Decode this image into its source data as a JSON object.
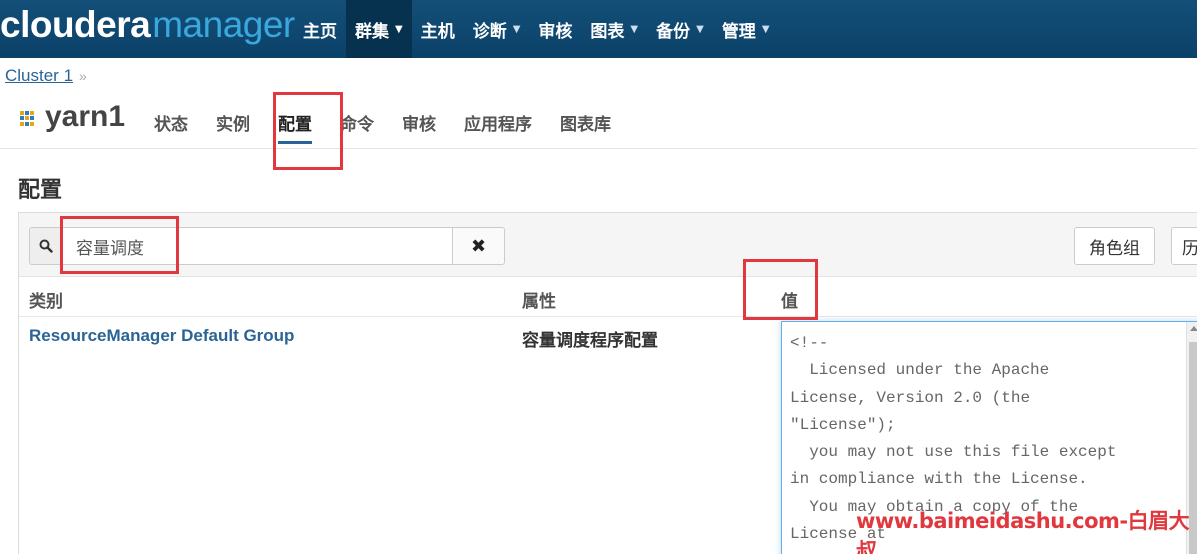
{
  "brand": {
    "part1": "cloudera",
    "part2": "manager"
  },
  "topnav": [
    {
      "label": "主页",
      "caret": false,
      "active": false
    },
    {
      "label": "群集",
      "caret": true,
      "active": true
    },
    {
      "label": "主机",
      "caret": false,
      "active": false
    },
    {
      "label": "诊断",
      "caret": true,
      "active": false
    },
    {
      "label": "审核",
      "caret": false,
      "active": false
    },
    {
      "label": "图表",
      "caret": true,
      "active": false
    },
    {
      "label": "备份",
      "caret": true,
      "active": false
    },
    {
      "label": "管理",
      "caret": true,
      "active": false
    }
  ],
  "breadcrumb": {
    "cluster": "Cluster 1",
    "sep": "»"
  },
  "service": {
    "name": "yarn1",
    "tabs": [
      {
        "label": "状态",
        "active": false
      },
      {
        "label": "实例",
        "active": false
      },
      {
        "label": "配置",
        "active": true
      },
      {
        "label": "命令",
        "active": false
      },
      {
        "label": "审核",
        "active": false
      },
      {
        "label": "应用程序",
        "active": false
      },
      {
        "label": "图表库",
        "active": false
      }
    ]
  },
  "page_title": "配置",
  "search": {
    "value": "容量调度",
    "clear_symbol": "✖"
  },
  "buttons": {
    "role_groups": "角色组",
    "history": "历"
  },
  "columns": {
    "category": "类别",
    "property": "属性",
    "value": "值"
  },
  "row": {
    "category": "ResourceManager Default Group",
    "property": "容量调度程序配置",
    "value": "<!--\n  Licensed under the Apache\nLicense, Version 2.0 (the\n\"License\");\n  you may not use this file except\nin compliance with the License.\n  You may obtain a copy of the\nLicense at"
  },
  "watermark": "www.baimeidashu.com-白眉大叔",
  "colors": {
    "nav_bg": "#134f78",
    "accent": "#2a6496",
    "highlight": "#e0383e"
  }
}
